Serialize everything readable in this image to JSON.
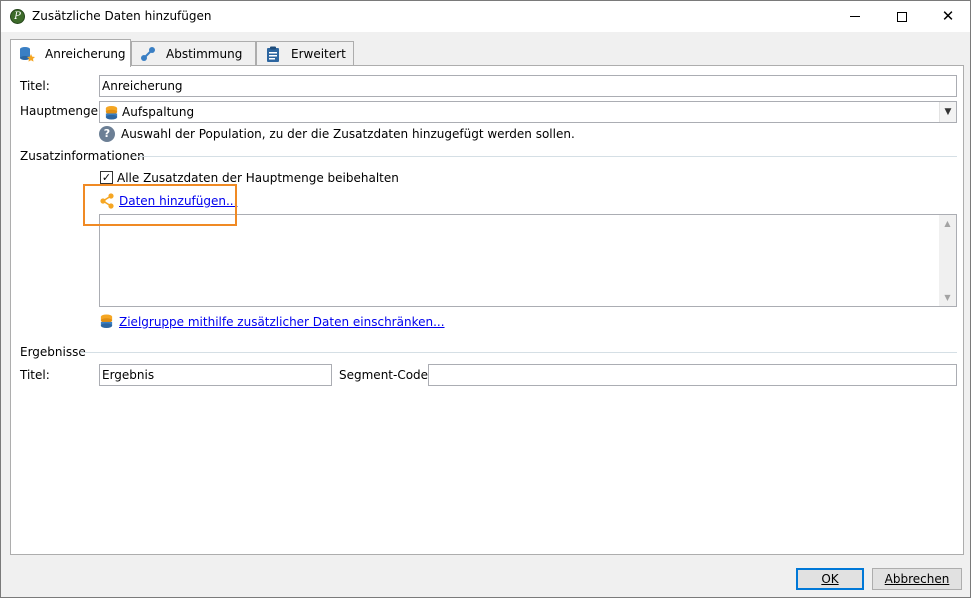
{
  "window": {
    "title": "Zusätzliche Daten hinzufügen",
    "app_icon_glyph": "P"
  },
  "tabs": [
    {
      "label": "Anreicherung",
      "icon": "database-star-icon",
      "active": true
    },
    {
      "label": "Abstimmung",
      "icon": "link-nodes-icon",
      "active": false
    },
    {
      "label": "Erweitert",
      "icon": "clipboard-icon",
      "active": false
    }
  ],
  "form": {
    "title_label": "Titel:",
    "title_value": "Anreicherung",
    "main_set_label": "Hauptmenge:",
    "main_set_value": "Aufspaltung",
    "help_text": "Auswahl der Population, zu der die Zusatzdaten hinzugefügt werden sollen."
  },
  "additional_info": {
    "group_label": "Zusatzinformationen",
    "keep_all_label": "Alle Zusatzdaten der Hauptmenge beibehalten",
    "keep_all_checked": true,
    "add_data_link": "Daten hinzufügen...",
    "restrict_link": "Zielgruppe mithilfe zusätzlicher Daten einschränken..."
  },
  "results": {
    "group_label": "Ergebnisse",
    "title_label": "Titel:",
    "title_value": "Ergebnis",
    "segment_code_label": "Segment-Code:",
    "segment_code_value": ""
  },
  "buttons": {
    "ok": "OK",
    "cancel": "Abbrechen"
  },
  "colors": {
    "highlight": "#f08a24",
    "link": "#0000ee",
    "default_button_border": "#0078d7",
    "accent_orange": "#f5a623",
    "accent_blue": "#3a7fc4"
  }
}
